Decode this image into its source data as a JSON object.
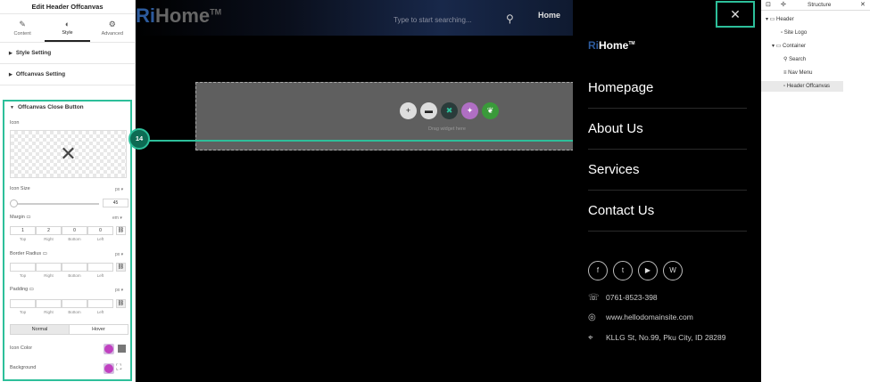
{
  "left_panel": {
    "title": "Edit Header Offcanvas",
    "tabs": [
      {
        "label": "Content",
        "icon": "pencil-icon"
      },
      {
        "label": "Style",
        "icon": "half-circle-icon"
      },
      {
        "label": "Advanced",
        "icon": "gear-icon"
      }
    ],
    "sections": [
      "Style Setting",
      "Offcanvas Setting",
      "Offcanvas Close Button"
    ],
    "icon_label": "Icon",
    "icon_size_label": "Icon Size",
    "icon_size_unit": "px",
    "icon_size_value": "45",
    "margin_label": "Margin",
    "margin_unit": "em",
    "margin_values": [
      "1",
      "2",
      "0",
      "0"
    ],
    "sides": [
      "Top",
      "Right",
      "Bottom",
      "Left"
    ],
    "border_radius_label": "Border Radius",
    "border_radius_unit": "px",
    "padding_label": "Padding",
    "padding_unit": "px",
    "states": [
      "Normal",
      "Hover"
    ],
    "icon_color_label": "Icon Color",
    "background_label": "Background"
  },
  "canvas": {
    "logo_prefix": "Ri",
    "logo_rest": "Home",
    "logo_mark": "TM",
    "search_placeholder": "Type to start searching...",
    "nav_home": "Home",
    "drop_text": "Drag widget here",
    "badge": "14"
  },
  "offcanvas": {
    "close_glyph": "✕",
    "logo_prefix": "Ri",
    "logo_rest": "Home",
    "logo_mark": "TM",
    "menu": [
      "Homepage",
      "About Us",
      "Services",
      "Contact Us"
    ],
    "phone": "0761-8523-398",
    "website": "www.hellodomainsite.com",
    "address": "KLLG St, No.99, Pku City, ID 28289"
  },
  "right_panel": {
    "title": "Structure",
    "tree": [
      "Header",
      "Site Logo",
      "Container",
      "Search",
      "Nav Menu",
      "Header Offcanvas"
    ]
  },
  "colors": {
    "accent": "#2dbf9a",
    "brand_blue": "#2c5a9c"
  }
}
